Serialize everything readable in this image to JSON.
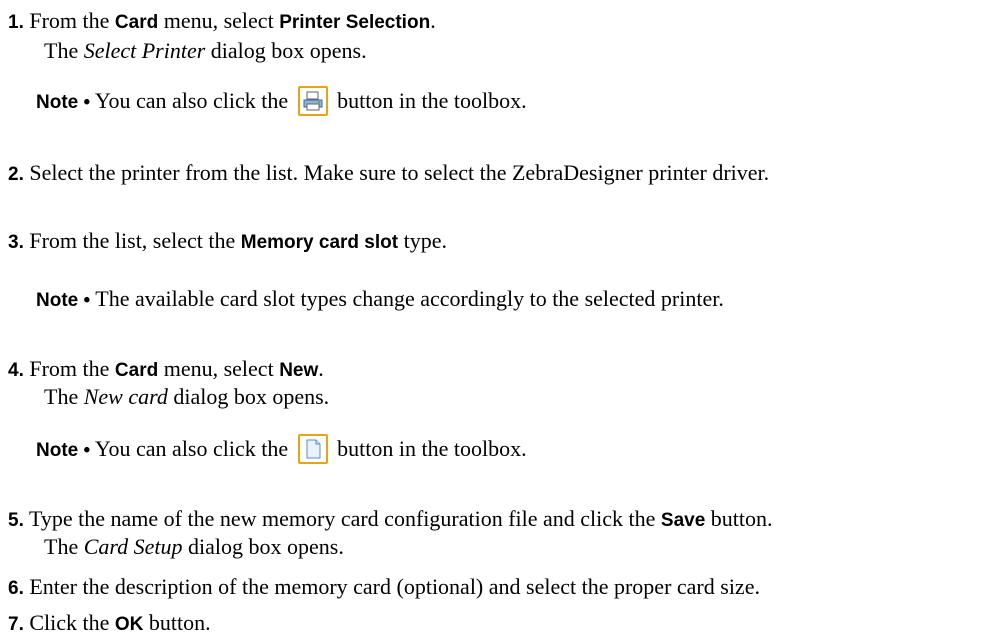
{
  "steps": [
    {
      "num": "1.",
      "pre": "From the ",
      "b1": "Card",
      "mid": " menu, select ",
      "b2": "Printer Selection",
      "end": ".",
      "sub_it": "Select Printer",
      "sub_rest": " dialog box opens."
    },
    {
      "num": "2.",
      "text": "Select the printer from the list. Make sure to select the ZebraDesigner printer driver."
    },
    {
      "num": "3.",
      "pre": "From the list, select the ",
      "b1": "Memory card slot",
      "end": " type."
    },
    {
      "num": "4.",
      "pre": "From the ",
      "b1": "Card",
      "mid": " menu, select ",
      "b2": "New",
      "end": ".",
      "sub_pre": "The ",
      "sub_it": "New card",
      "sub_rest": " dialog box opens."
    },
    {
      "num": "5.",
      "pre": "Type the name of the new memory card configuration file and click the ",
      "b1": "Save",
      "end": " button.",
      "sub_pre": "The ",
      "sub_it": "Card Setup",
      "sub_rest": " dialog box opens."
    },
    {
      "num": "6.",
      "text": "Enter the description of the memory card (optional) and select the proper card size."
    },
    {
      "num": "7.",
      "pre": "Click the ",
      "b1": "OK",
      "end": " button."
    }
  ],
  "sub1_pre": "The ",
  "notes": {
    "label": "Note •",
    "n1_pre": " You can also click the ",
    "n1_post": " button in the toolbox.",
    "n2": " The available card slot types change accordingly to the selected printer.",
    "n3_pre": " You can also click the ",
    "n3_post": " button in the toolbox."
  },
  "icons": {
    "printer": "printer-icon",
    "new_card": "new-document-icon"
  }
}
